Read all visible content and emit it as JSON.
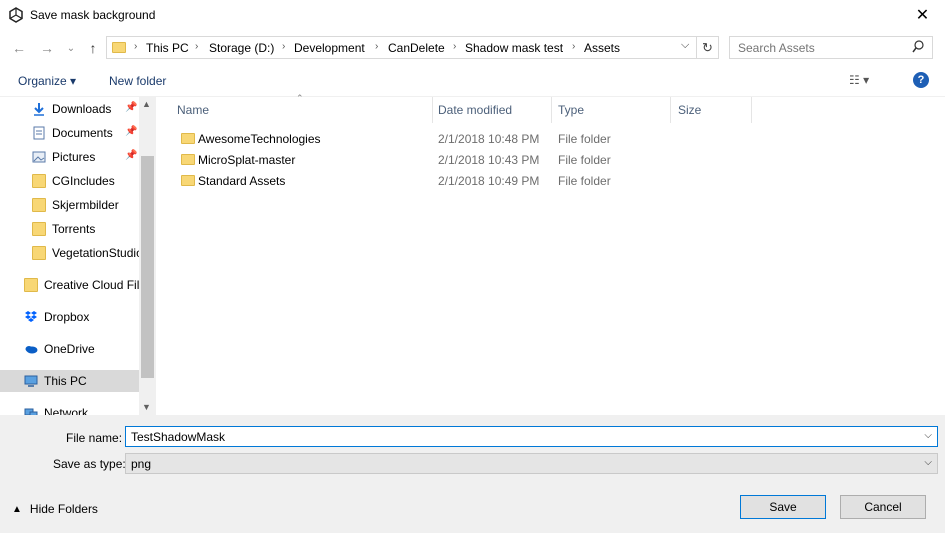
{
  "window": {
    "title": "Save mask background",
    "close_glyph": "✕"
  },
  "nav": {
    "back_glyph": "←",
    "forward_glyph": "→",
    "recent_glyph": "⌄",
    "up_glyph": "↑",
    "breadcrumbs": [
      "This PC",
      "Storage (D:)",
      "Development",
      "CanDelete",
      "Shadow mask test",
      "Assets"
    ],
    "refresh_glyph": "↻",
    "search_placeholder": "Search Assets"
  },
  "toolbar": {
    "organize": "Organize ▾",
    "new_folder": "New folder",
    "help": "?"
  },
  "sidebar": {
    "items": [
      {
        "label": "Downloads",
        "icon": "download-icon",
        "pinned": true
      },
      {
        "label": "Documents",
        "icon": "document-icon",
        "pinned": true
      },
      {
        "label": "Pictures",
        "icon": "pictures-icon",
        "pinned": true
      },
      {
        "label": "CGIncludes",
        "icon": "folder-icon"
      },
      {
        "label": "Skjermbilder",
        "icon": "folder-sync-icon"
      },
      {
        "label": "Torrents",
        "icon": "folder-icon"
      },
      {
        "label": "VegetationStudio",
        "icon": "folder-sync-icon"
      },
      {
        "label": "Creative Cloud Files",
        "icon": "creative-cloud-icon"
      },
      {
        "label": "Dropbox",
        "icon": "dropbox-icon"
      },
      {
        "label": "OneDrive",
        "icon": "onedrive-icon"
      },
      {
        "label": "This PC",
        "icon": "computer-icon",
        "selected": true
      },
      {
        "label": "Network",
        "icon": "network-icon"
      }
    ]
  },
  "files": {
    "columns": [
      "Name",
      "Date modified",
      "Type",
      "Size"
    ],
    "rows": [
      {
        "name": "AwesomeTechnologies",
        "date": "2/1/2018 10:48 PM",
        "type": "File folder"
      },
      {
        "name": "MicroSplat-master",
        "date": "2/1/2018 10:43 PM",
        "type": "File folder"
      },
      {
        "name": "Standard Assets",
        "date": "2/1/2018 10:49 PM",
        "type": "File folder"
      }
    ]
  },
  "form": {
    "file_name_label": "File name:",
    "file_name_value": "TestShadowMask",
    "save_type_label": "Save as type:",
    "save_type_value": "png",
    "hide_folders": "Hide Folders",
    "save": "Save",
    "cancel": "Cancel"
  },
  "colors": {
    "accent": "#0078d7",
    "folder": "#f8d775",
    "selected": "#d9d9d9"
  }
}
